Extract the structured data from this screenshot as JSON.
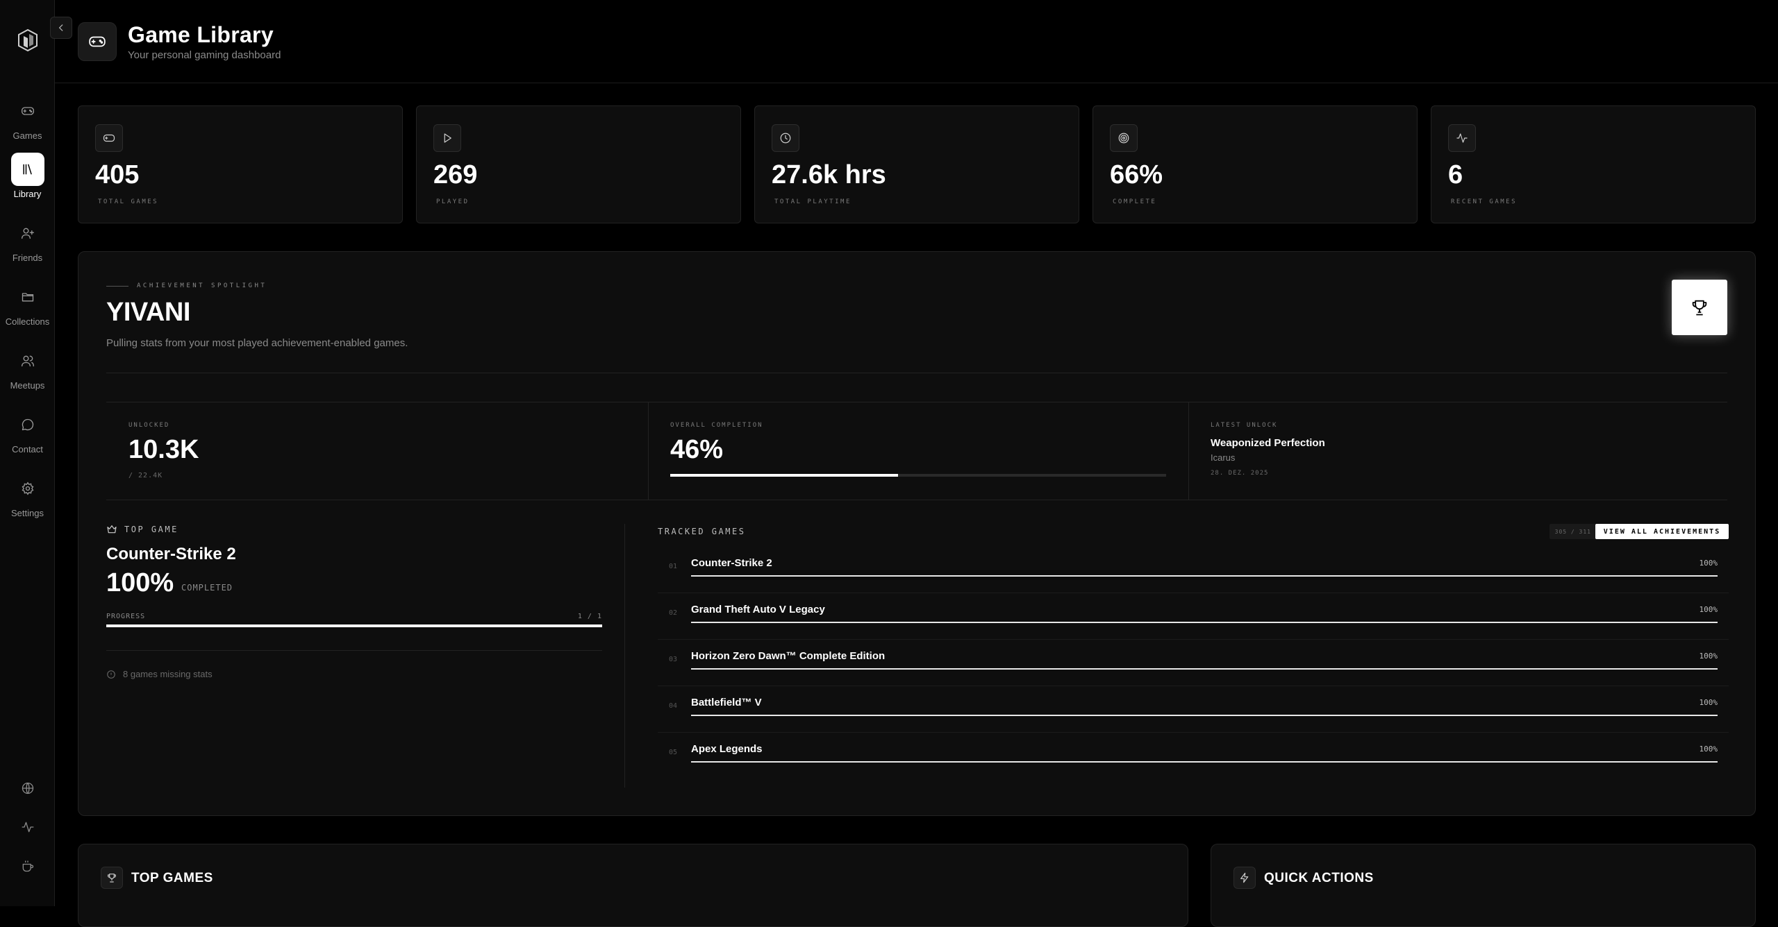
{
  "sidebar": {
    "items": [
      {
        "label": "Games",
        "icon": "gamepad-icon"
      },
      {
        "label": "Library",
        "icon": "library-icon",
        "active": true
      },
      {
        "label": "Friends",
        "icon": "user-plus-icon"
      },
      {
        "label": "Collections",
        "icon": "folder-icon"
      },
      {
        "label": "Meetups",
        "icon": "users-icon"
      },
      {
        "label": "Contact",
        "icon": "chat-icon"
      },
      {
        "label": "Settings",
        "icon": "gear-icon"
      }
    ],
    "bottom_icons": [
      "globe-icon",
      "activity-icon",
      "coffee-icon"
    ]
  },
  "header": {
    "title": "Game Library",
    "subtitle": "Your personal gaming dashboard"
  },
  "stats": [
    {
      "value": "405",
      "label": "TOTAL GAMES",
      "icon": "gamepad-icon"
    },
    {
      "value": "269",
      "label": "PLAYED",
      "icon": "play-icon"
    },
    {
      "value": "27.6k hrs",
      "label": "TOTAL PLAYTIME",
      "icon": "clock-icon"
    },
    {
      "value": "66%",
      "label": "COMPLETE",
      "icon": "target-icon"
    },
    {
      "value": "6",
      "label": "RECENT GAMES",
      "icon": "activity-icon"
    }
  ],
  "spotlight": {
    "eyebrow": "ACHIEVEMENT SPOTLIGHT",
    "name": "YIVANI",
    "description": "Pulling stats from your most played achievement-enabled games.",
    "unlocked": {
      "label": "UNLOCKED",
      "value": "10.3K",
      "sub": "/ 22.4K"
    },
    "completion": {
      "label": "OVERALL COMPLETION",
      "value": "46%",
      "fraction": 0.46
    },
    "latest": {
      "label": "LATEST UNLOCK",
      "title": "Weaponized Perfection",
      "game": "Icarus",
      "date": "28. DEZ. 2025"
    }
  },
  "top_game": {
    "heading": "TOP GAME",
    "name": "Counter-Strike 2",
    "percent": "100%",
    "completed_label": "COMPLETED",
    "progress_label": "PROGRESS",
    "progress_count": "1 / 1",
    "progress_fraction": 1.0,
    "missing_note": "8 games missing stats"
  },
  "tracked": {
    "title": "TRACKED GAMES",
    "count": "305 / 311",
    "button": "VIEW ALL ACHIEVEMENTS",
    "rows": [
      {
        "num": "01",
        "name": "Counter-Strike 2",
        "pct": "100%",
        "fraction": 1.0
      },
      {
        "num": "02",
        "name": "Grand Theft Auto V Legacy",
        "pct": "100%",
        "fraction": 1.0
      },
      {
        "num": "03",
        "name": "Horizon Zero Dawn™ Complete Edition",
        "pct": "100%",
        "fraction": 1.0
      },
      {
        "num": "04",
        "name": "Battlefield™ V",
        "pct": "100%",
        "fraction": 1.0
      },
      {
        "num": "05",
        "name": "Apex Legends",
        "pct": "100%",
        "fraction": 1.0
      }
    ]
  },
  "panels": {
    "top_games": "TOP GAMES",
    "quick_actions": "QUICK ACTIONS"
  }
}
